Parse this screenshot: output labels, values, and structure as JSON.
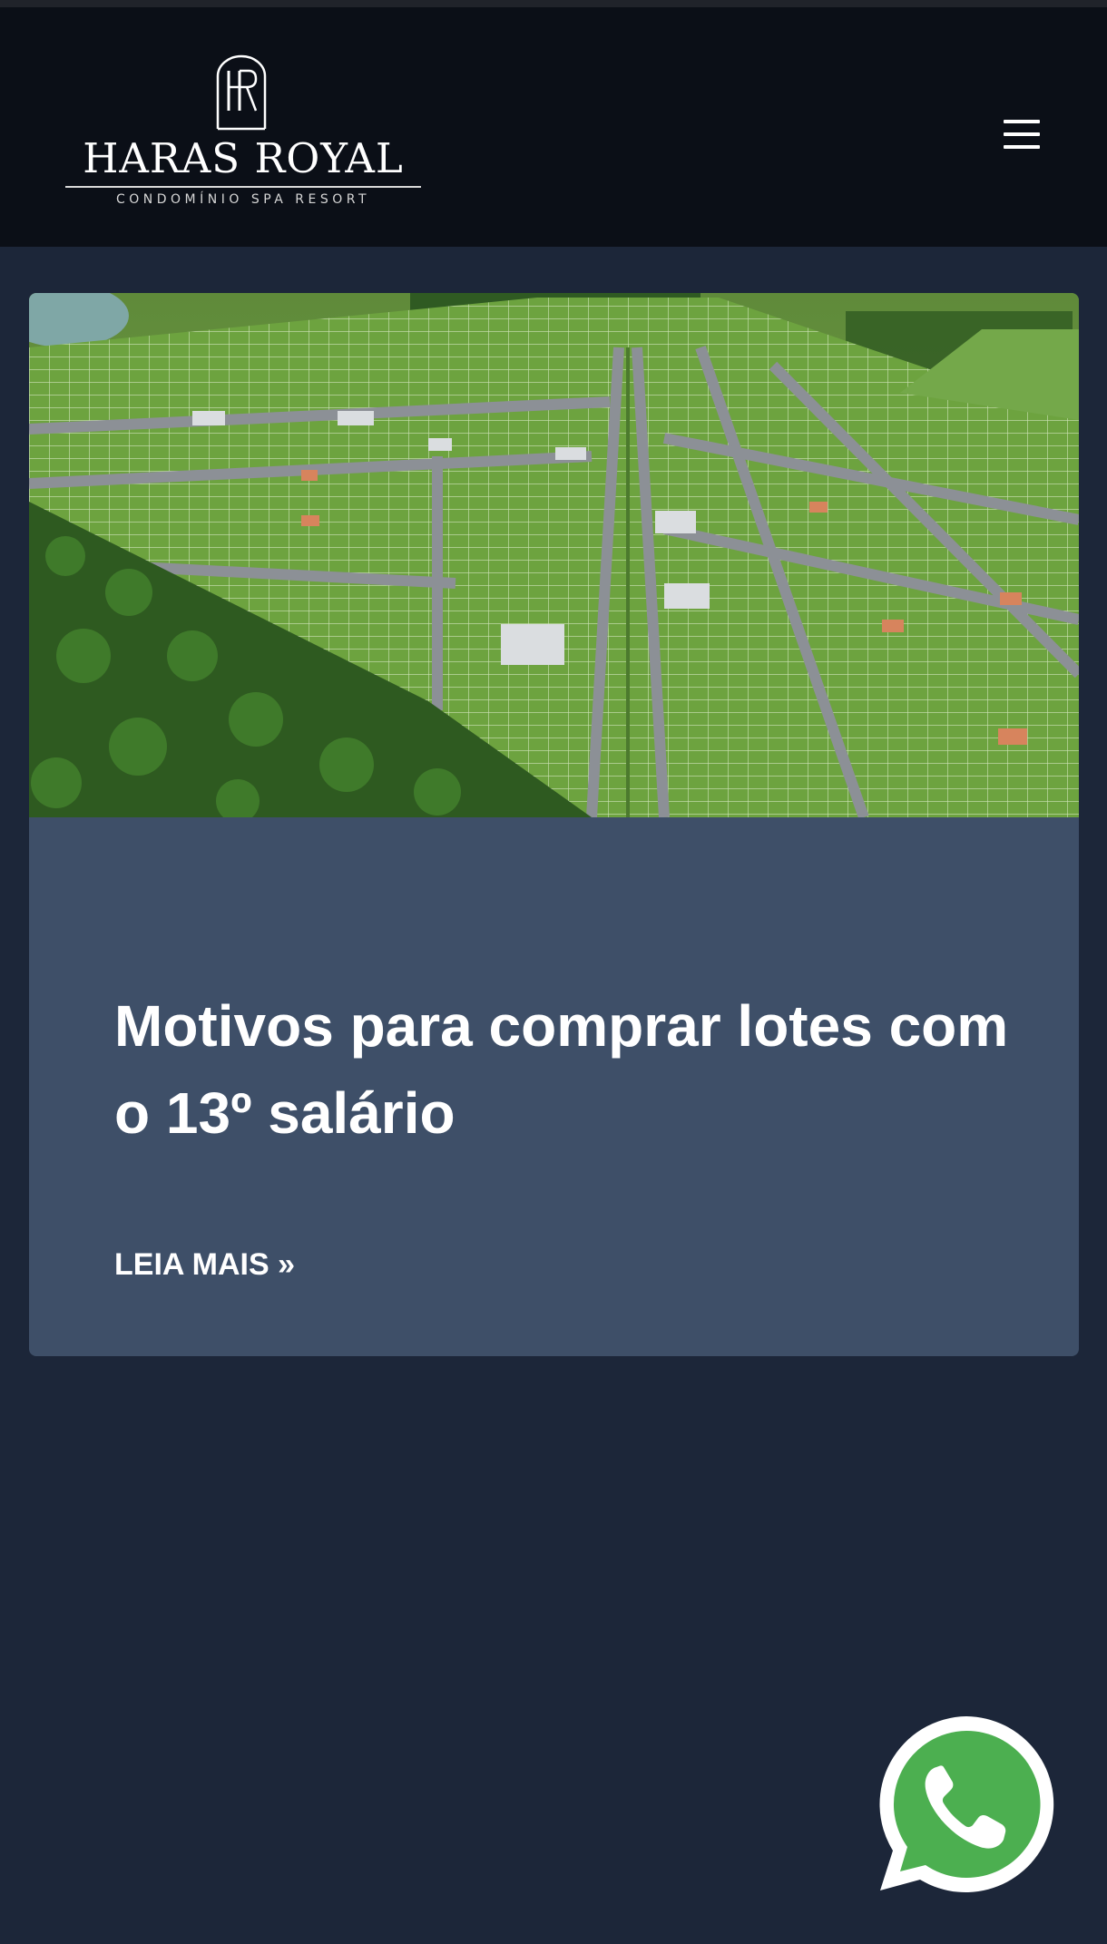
{
  "header": {
    "logo": {
      "monogram": "HR",
      "name": "HARAS ROYAL",
      "tagline": "CONDOMÍNIO SPA RESORT"
    },
    "menu_icon": "hamburger-menu-icon"
  },
  "post": {
    "image_description": "aerial-rendering-of-subdivided-lots",
    "title": "Motivos para comprar lotes com o 13º salário",
    "read_more_label": "LEIA MAIS »"
  },
  "floating": {
    "whatsapp_icon": "whatsapp-icon"
  },
  "colors": {
    "page_background": "#1c2639",
    "header_background": "#0b0f17",
    "card_background": "#3e4f68",
    "text": "#ffffff",
    "whatsapp_green": "#4caf50"
  }
}
